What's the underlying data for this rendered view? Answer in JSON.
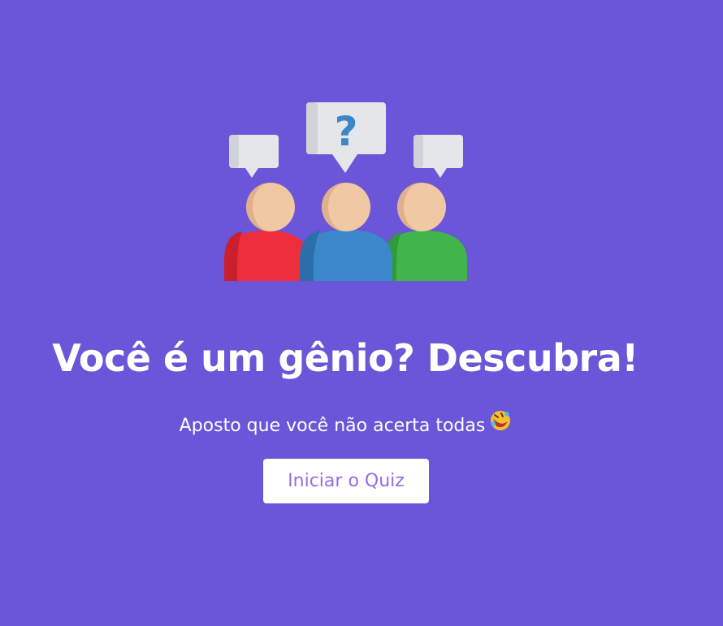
{
  "hero": {
    "illustration_icon": "people-question-icon",
    "bubble_symbol": "?"
  },
  "title": "Você é um gênio? Descubra!",
  "subtitle": {
    "text": "Aposto que você não acerta todas",
    "emoji_icon": "rolling-on-floor-laughing-icon"
  },
  "actions": {
    "start_label": "Iniciar o Quiz"
  },
  "colors": {
    "background": "#6b55d8",
    "button_background": "#ffffff",
    "button_text": "#8f6fe8",
    "person_left": "#ee2e3c",
    "person_center": "#3a88c9",
    "person_right": "#3fb54c",
    "skin": "#f0c8a4",
    "bubble": "#e4e6ea"
  }
}
